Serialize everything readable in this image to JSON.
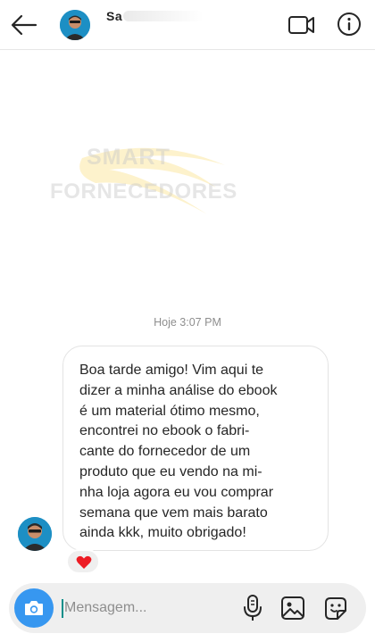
{
  "header": {
    "contact_name": "Sa",
    "icons": [
      "back-arrow-icon",
      "video-call-icon",
      "info-icon"
    ]
  },
  "watermark": {
    "line1": "SMART",
    "line2": "FORNECEDORES",
    "accent_color": "#f5c518"
  },
  "conversation": {
    "timestamp": "Hoje 3:07 PM",
    "message_lines": [
      "Boa tarde amigo! Vim aqui te",
      "dizer a minha análise do ebook",
      "é um material ótimo mesmo,",
      "encontrei no ebook o fabri-",
      "cante do fornecedor de um",
      "produto que eu vendo na mi-",
      "nha loja agora eu vou comprar",
      "semana que vem mais barato",
      "ainda kkk, muito obrigado!"
    ],
    "reaction": "heart"
  },
  "composer": {
    "placeholder": "Mensagem...",
    "icons": [
      "camera-icon",
      "microphone-icon",
      "image-icon",
      "sticker-icon"
    ],
    "camera_color": "#3797f0"
  },
  "colors": {
    "reaction_heart": "#ed1c24",
    "timestamp": "#8e8e8e",
    "bubble_border": "#e3e3e3"
  }
}
